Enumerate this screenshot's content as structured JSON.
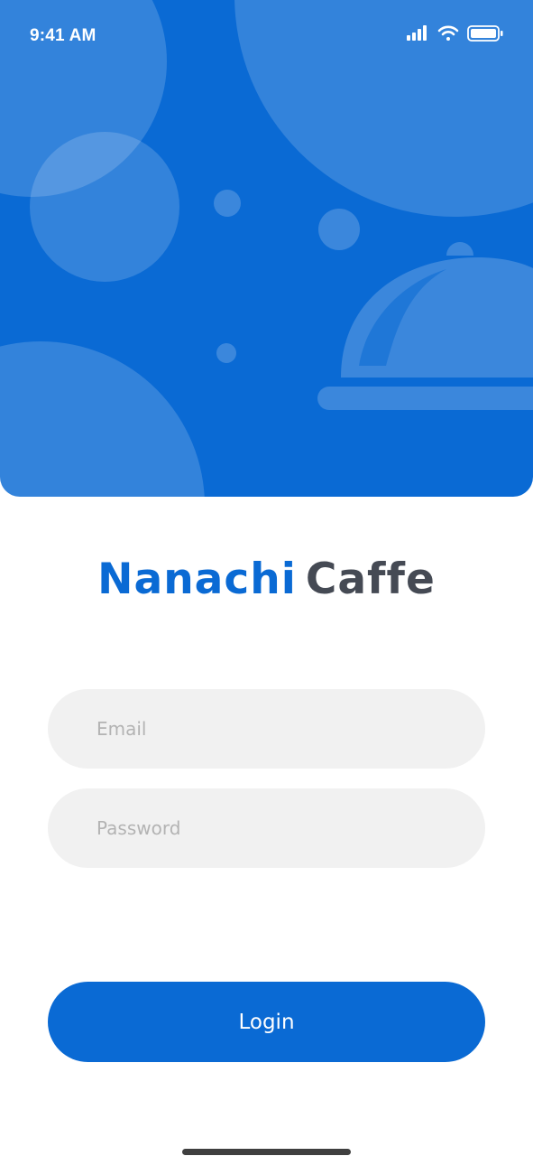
{
  "status_bar": {
    "time": "9:41 AM",
    "icons": [
      "cellular-signal-icon",
      "wifi-icon",
      "battery-icon"
    ]
  },
  "hero": {
    "illustration": "serving-cloche-icon",
    "background_color": "#0a6ad4",
    "bubble_color": "#ffffff"
  },
  "brand": {
    "part_1": "Nanachi",
    "part_2": "Caffe",
    "primary_color": "#0a6ad4",
    "secondary_color": "#454a54"
  },
  "login_form": {
    "email_placeholder": "Email",
    "password_placeholder": "Password",
    "submit_label": "Login"
  }
}
